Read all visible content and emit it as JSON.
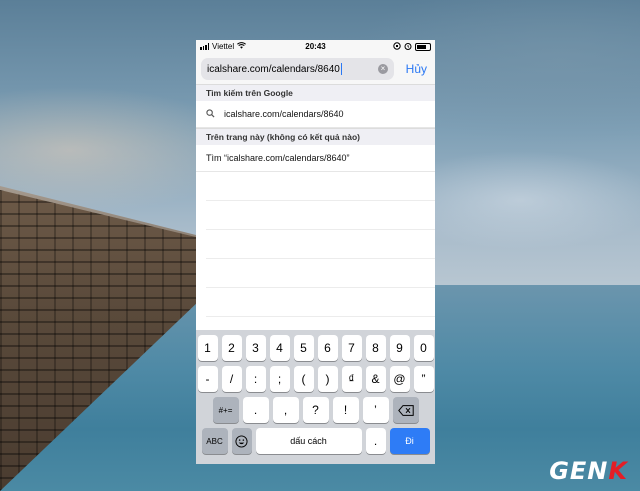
{
  "status_bar": {
    "carrier": "Viettel",
    "time": "20:43"
  },
  "search": {
    "url_value": "icalshare.com/calendars/8640",
    "cancel_label": "Hủy"
  },
  "results": {
    "google_header": "Tìm kiếm trên Google",
    "google_suggestion": "icalshare.com/calendars/8640",
    "on_page_header": "Trên trang này (không có kết quả nào)",
    "find_on_page": "Tìm “icalshare.com/calendars/8640”"
  },
  "keyboard": {
    "row1": [
      "1",
      "2",
      "3",
      "4",
      "5",
      "6",
      "7",
      "8",
      "9",
      "0"
    ],
    "row2": [
      "-",
      "/",
      ":",
      ";",
      "(",
      ")",
      "₫",
      "&",
      "@",
      "”"
    ],
    "row3_mode": "#+=",
    "row3": [
      ".",
      ",",
      "?",
      "!",
      "’"
    ],
    "abc_label": "ABC",
    "space_label": "dấu cách",
    "period_label": ".",
    "go_label": "Đi"
  },
  "watermark": "GENK"
}
